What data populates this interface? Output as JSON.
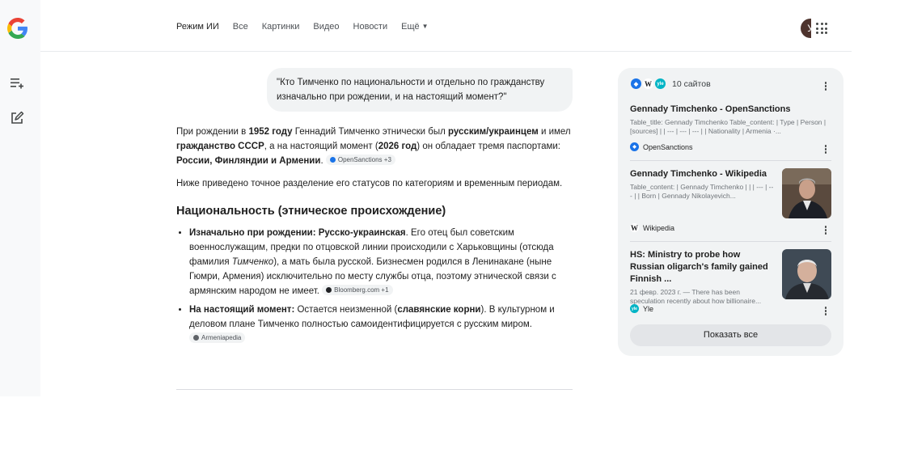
{
  "nav": {
    "tabs": [
      {
        "label": "Режим ИИ",
        "active": true
      },
      {
        "label": "Все"
      },
      {
        "label": "Картинки"
      },
      {
        "label": "Видео"
      },
      {
        "label": "Новости"
      },
      {
        "label": "Ещё"
      }
    ],
    "avatar_letter": "У",
    "icons": {
      "logo": "google-logo",
      "apps": "apps-grid-icon",
      "history": "history-list-icon",
      "new_chat": "edit-icon"
    }
  },
  "query": "\"Кто Тимченко по национальности и отдельно по гражданству изначально при рождении, и на настоящий момент?\"",
  "answer": {
    "p1": {
      "a": "При рождении в ",
      "b1": "1952 году",
      "c": " Геннадий Тимченко этнически был ",
      "b2": "русским/украинцем",
      "d": " и имел ",
      "b3": "гражданство СССР",
      "e": ", а на настоящий момент (",
      "b4": "2026 год",
      "f": ") он обладает тремя паспортами: ",
      "b5": "России, Финляндии и Армении",
      "g": ".",
      "chip": "OpenSanctions +3"
    },
    "p2": "Ниже приведено точное разделение его статусов по категориям и временным периодам.",
    "section_title": "Национальность (этническое происхождение)",
    "bullet1": {
      "lead": "Изначально при рождении: Русско-украинская",
      "a": ". Его отец был советским военнослужащим, предки по отцовской линии происходили с Харьковщины (отсюда фамилия ",
      "i": "Тимченко",
      "b": "), а мать была русской. Бизнесмен родился в Ленинакане (ныне Гюмри, Армения) исключительно по месту службы отца, поэтому этнической связи с армянским народом не имеет.",
      "chip": "Bloomberg.com +1"
    },
    "bullet2": {
      "lead": "На настоящий момент:",
      "a": " Остается неизменной (",
      "b": "славянские корни",
      "c": "). В культурном и деловом плане Тимченко полностью самоидентифицируется с русским миром.",
      "chip": "Armeniapedia"
    }
  },
  "sources": {
    "count_label": "10 сайтов",
    "items": [
      {
        "title": "Gennady Timchenko - OpenSanctions",
        "snippet": "Table_title: Gennady Timchenko Table_content: | Type | Person | [sources] | | --- | --- | --- | | Nationality | Armenia ·...",
        "site": "OpenSanctions"
      },
      {
        "title": "Gennady Timchenko - Wikipedia",
        "snippet": "Table_content: | Gennady Timchenko | | | --- | --- | | Born | Gennady Nikolayevich...",
        "site": "Wikipedia"
      },
      {
        "title": "HS: Ministry to probe how Russian oligarch's family gained Finnish ...",
        "snippet": "21 февр. 2023 г. — There has been speculation recently about how billionaire...",
        "site": "Yle"
      }
    ],
    "show_all": "Показать все"
  },
  "colors": {
    "accent": "#1a73e8",
    "panel": "#f1f3f4",
    "text": "#1f1f1f"
  }
}
